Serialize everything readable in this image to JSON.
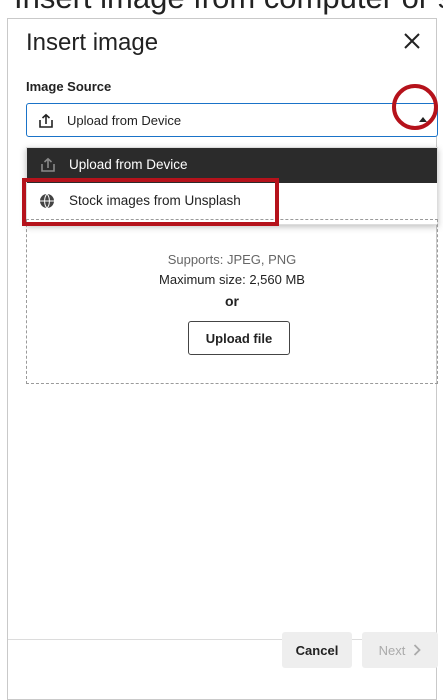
{
  "dialog": {
    "top_strip_text": "Insert image from computer or stock image",
    "title": "Insert image",
    "close_icon": "close-icon"
  },
  "source": {
    "label": "Image Source",
    "selected": "Upload from Device",
    "options": [
      {
        "label": "Upload from Device",
        "icon": "upload-icon"
      },
      {
        "label": "Stock images from Unsplash",
        "icon": "globe-icon"
      }
    ]
  },
  "dropzone": {
    "supports": "Supports: JPEG, PNG",
    "max_size": "Maximum size: 2,560 MB",
    "or": "or",
    "upload_button": "Upload file"
  },
  "footer": {
    "cancel": "Cancel",
    "next": "Next"
  },
  "colors": {
    "highlight": "#b5121b",
    "selected_bg": "#2b2b2b",
    "focus": "#1a73c8"
  }
}
